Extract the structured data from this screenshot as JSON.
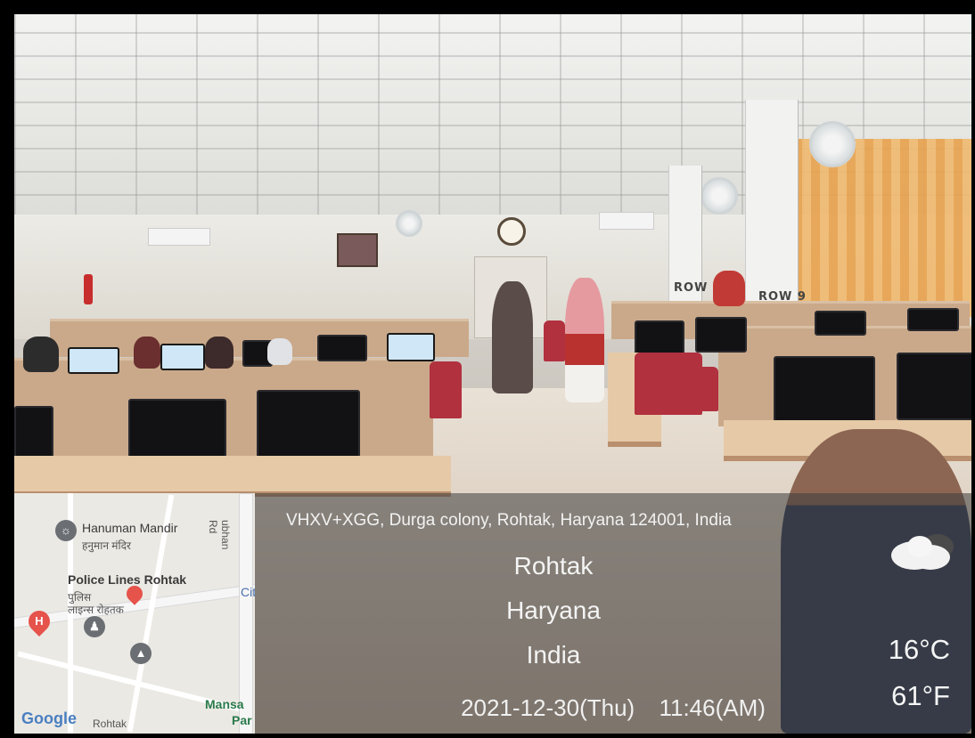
{
  "location": {
    "address": "VHXV+XGG, Durga colony, Rohtak, Haryana 124001, India",
    "city": "Rohtak",
    "state": "Haryana",
    "country": "India"
  },
  "datetime": {
    "date": "2021-12-30(Thu)",
    "time": "11:46(AM)"
  },
  "weather": {
    "temp_c": "16°C",
    "temp_f": "61°F",
    "icon": "cloud-icon"
  },
  "map": {
    "poi_temple_name": "Hanuman Mandir",
    "poi_temple_local": "हनुमान मंदिर",
    "poi_police_name": "Police Lines Rohtak",
    "poi_police_local_1": "पुलिस",
    "poi_police_local_2": "लाइन्स रोहतक",
    "road_label": "ubhan Rd",
    "mansa_label_1": "Mansa",
    "mansa_label_2": "Par",
    "rohtak_label": "Rohtak",
    "city_label": "Cit",
    "logo": "Google"
  },
  "scene_signs": {
    "row_label_1": "ROW 8",
    "row_label_2": "ROW 9"
  },
  "colors": {
    "overlay_bg": "#3c3c3c",
    "map_bg": "#ebe9e4",
    "pin_red": "#e5534b",
    "pin_gray": "#6b6f73"
  }
}
